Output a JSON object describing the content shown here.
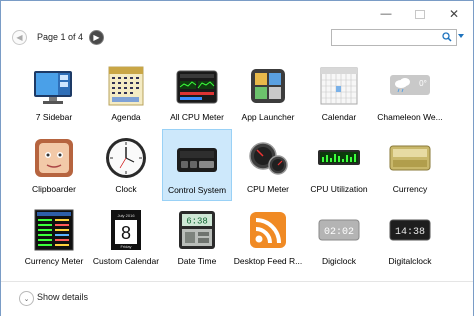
{
  "window": {
    "minimize": "—",
    "close": "✕"
  },
  "toolbar": {
    "prev_glyph": "◀",
    "next_glyph": "▶",
    "page_label": "Page 1 of 4",
    "search": {
      "value": "",
      "placeholder": ""
    }
  },
  "gadgets": [
    {
      "label": "7 Sidebar"
    },
    {
      "label": "Agenda"
    },
    {
      "label": "All CPU Meter"
    },
    {
      "label": "App Launcher"
    },
    {
      "label": "Calendar"
    },
    {
      "label": "Chameleon We..."
    },
    {
      "label": "Clipboarder"
    },
    {
      "label": "Clock"
    },
    {
      "label": "Control System",
      "selected": true
    },
    {
      "label": "CPU Meter"
    },
    {
      "label": "CPU Utilization"
    },
    {
      "label": "Currency"
    },
    {
      "label": "Currency Meter"
    },
    {
      "label": "Custom Calendar"
    },
    {
      "label": "Date Time"
    },
    {
      "label": "Desktop Feed R..."
    },
    {
      "label": "Digiclock"
    },
    {
      "label": "Digitalclock"
    }
  ],
  "thumb_text": {
    "custom_calendar_month": "July 2016",
    "custom_calendar_day": "8",
    "custom_calendar_weekday": "Friday",
    "date_time_clock": "6:38",
    "digiclock_time": "02:02",
    "digitalclock_time": "14:38",
    "chameleon_temp": "0°"
  },
  "footer": {
    "show_details_label": "Show details",
    "toggle_glyph": "⌄"
  }
}
